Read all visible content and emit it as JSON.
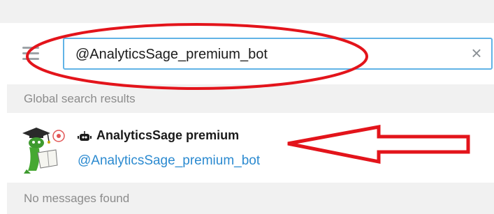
{
  "search": {
    "query": "@AnalyticsSage_premium_bot",
    "placeholder": ""
  },
  "sections": {
    "global_results_header": "Global search results",
    "no_messages": "No messages found"
  },
  "result": {
    "name": "AnalyticsSage premium",
    "username": "@AnalyticsSage_premium_bot"
  },
  "colors": {
    "accent": "#61b3e6",
    "link": "#2b8ad0",
    "annotation": "#e3141b"
  },
  "icons": {
    "menu": "hamburger-menu-icon",
    "clear": "close-icon",
    "bot": "bot-icon",
    "avatar": "bot-avatar"
  }
}
